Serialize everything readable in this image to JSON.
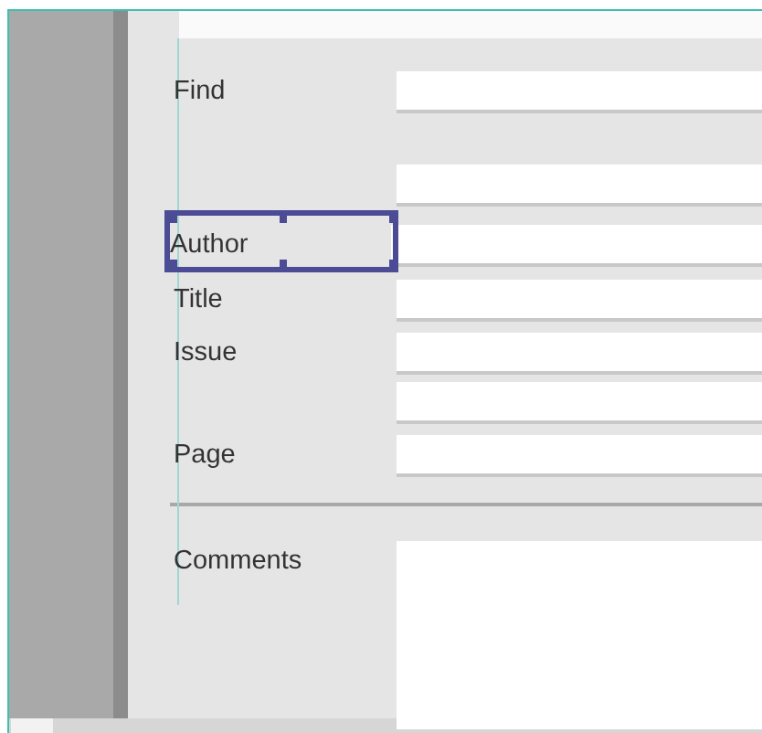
{
  "form": {
    "rows": [
      {
        "kind": "field",
        "label": "Find",
        "selected": false
      },
      {
        "kind": "field",
        "selected": false
      },
      {
        "kind": "field",
        "label": "Author",
        "selected": true
      },
      {
        "kind": "field",
        "label": "Title",
        "selected": false
      },
      {
        "kind": "field",
        "label": "Issue",
        "selected": false
      },
      {
        "kind": "field",
        "selected": false
      },
      {
        "kind": "field",
        "label": "Page",
        "selected": false
      },
      {
        "kind": "divider"
      },
      {
        "kind": "memo",
        "label": "Comments",
        "selected": false
      }
    ]
  }
}
